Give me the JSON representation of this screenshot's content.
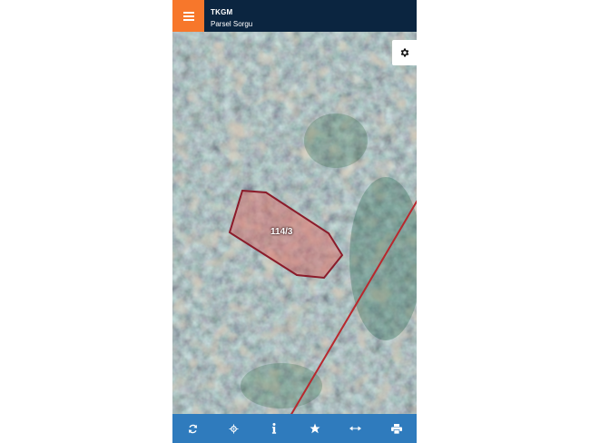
{
  "header": {
    "title": "TKGM",
    "subtitle": "Parsel Sorgu",
    "menu_icon": "hamburger-icon",
    "accent_color": "#f7772b",
    "bar_color": "#0b2540"
  },
  "map": {
    "parcel_label": "114/3",
    "settings_icon": "gear-icon"
  },
  "toolbar": {
    "color": "#2f7bbd",
    "items": [
      {
        "icon": "refresh-icon"
      },
      {
        "icon": "locate-icon"
      },
      {
        "icon": "info-icon"
      },
      {
        "icon": "star-icon"
      },
      {
        "icon": "measure-icon"
      },
      {
        "icon": "print-icon"
      }
    ]
  }
}
